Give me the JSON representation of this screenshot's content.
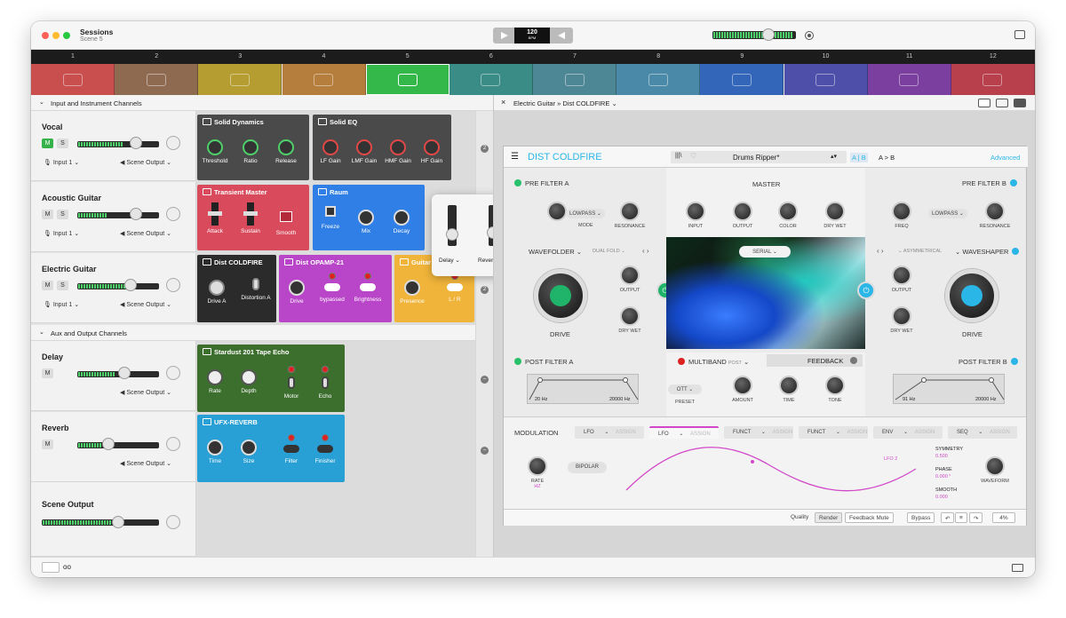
{
  "window": {
    "title": "Sessions",
    "subtitle": "Scene 5",
    "tempo": "120",
    "tempo_unit": "BPM"
  },
  "colors": {
    "accent_green": "#35b34a",
    "blue_power": "#2ab6e6"
  },
  "track_numbers": [
    "1",
    "2",
    "3",
    "4",
    "5",
    "6",
    "7",
    "8",
    "9",
    "10",
    "11",
    "12"
  ],
  "track_colors": [
    "#c94f4f",
    "#8d6a50",
    "#b59d32",
    "#b67e3c",
    "#34b84a",
    "#3a8c86",
    "#4d8694",
    "#4a8aa8",
    "#3366b8",
    "#4e4fa8",
    "#7b3f9f",
    "#b8404c"
  ],
  "sections": {
    "input": "Input and Instrument Channels",
    "aux": "Aux and Output Channels"
  },
  "channels": [
    {
      "name": "Vocal",
      "m": "M",
      "s": "S",
      "input": "Input 1",
      "output": "Scene Output",
      "level": 0.55,
      "thumb": 0.72
    },
    {
      "name": "Acoustic Guitar",
      "m": "M",
      "s": "S",
      "input": "Input 1",
      "output": "Scene Output",
      "level": 0.35,
      "thumb": 0.72
    },
    {
      "name": "Electric Guitar",
      "m": "M",
      "s": "S",
      "input": "Input 1",
      "output": "Scene Output",
      "level": 0.7,
      "thumb": 0.65
    }
  ],
  "aux_channels": [
    {
      "name": "Delay",
      "m": "M",
      "output": "Scene Output",
      "level": 0.45,
      "thumb": 0.58
    },
    {
      "name": "Reverb",
      "m": "M",
      "output": "Scene Output",
      "level": 0.3,
      "thumb": 0.38
    }
  ],
  "scene_output": {
    "name": "Scene Output",
    "level": 0.6,
    "thumb": 0.65
  },
  "plugins": {
    "solid_dynamics": {
      "name": "Solid Dynamics",
      "controls": [
        "Threshold",
        "Ratio",
        "Release"
      ]
    },
    "solid_eq": {
      "name": "Solid EQ",
      "controls": [
        "LF Gain",
        "LMF Gain",
        "HMF Gain",
        "HF Gain"
      ]
    },
    "transient": {
      "name": "Transient Master",
      "controls": [
        "Attack",
        "Sustain",
        "Smooth"
      ]
    },
    "raum": {
      "name": "Raum",
      "controls": [
        "Freeze",
        "Mix",
        "Decay"
      ]
    },
    "dist": {
      "name": "Dist COLDFIRE",
      "controls": [
        "Drive A",
        "Distortion A"
      ]
    },
    "opamp": {
      "name": "Dist OPAMP-21",
      "controls": [
        "Drive",
        "bypassed",
        "Brightness"
      ]
    },
    "guitar": {
      "name": "Guitar",
      "controls": [
        "Presence",
        "L / R"
      ]
    },
    "stardust": {
      "name": "Stardust 201 Tape Echo",
      "controls": [
        "Rate",
        "Depth",
        "Motor",
        "Echo"
      ]
    },
    "ufx": {
      "name": "UFX-REVERB",
      "controls": [
        "Time",
        "Size",
        "Filter",
        "Finisher"
      ]
    }
  },
  "sends_popup": {
    "items": [
      "Delay",
      "Reverb"
    ]
  },
  "editor": {
    "breadcrumb": "Electric Guitar » Dist COLDFIRE"
  },
  "coldfire": {
    "name": "DIST COLDFIRE",
    "preset": "Drums Ripper*",
    "ab": "A | B",
    "a_to_b": "A > B",
    "advanced": "Advanced",
    "pre_filter_a": "PRE FILTER A",
    "pre_filter_b": "PRE FILTER B",
    "master": "MASTER",
    "mode_a": "LOWPASS",
    "mode_b": "LOWPASS",
    "mode_label": "MODE",
    "resonance": "RESONANCE",
    "freq": "FREQ",
    "master_knobs": [
      "INPUT",
      "OUTPUT",
      "COLOR",
      "DRY WET"
    ],
    "wavefolder": "WAVEFOLDER",
    "dual_fold": "DUAL FOLD",
    "waveshaper": "WAVESHAPER",
    "asymmetrical": "ASYMMETRICAL",
    "output": "OUTPUT",
    "dry_wet": "DRY WET",
    "drive": "DRIVE",
    "serial": "SERIAL",
    "multiband": "MULTIBAND",
    "post": "POST",
    "feedback": "FEEDBACK",
    "ott": "OTT",
    "preset_label": "PRESET",
    "fb_knobs": [
      "AMOUNT",
      "TIME",
      "TONE"
    ],
    "post_filter_a": "POST FILTER A",
    "post_filter_b": "POST FILTER B",
    "pfa_low": "20 Hz",
    "pfa_high": "20000 Hz",
    "pfb_low": "91 Hz",
    "pfb_high": "20000 Hz",
    "modulation": "MODULATION",
    "mod_tabs": [
      "LFO",
      "LFO",
      "FUNCT",
      "FUNCT",
      "ENV",
      "SEQ"
    ],
    "assign": "ASSIGN",
    "rate": "RATE",
    "rate_unit": "HZ",
    "bipolar": "BIPOLAR",
    "lfo2": "LFO 2",
    "symmetry": "SYMMETRY",
    "symmetry_val": "0.500",
    "phase": "PHASE",
    "phase_val": "0.000 °",
    "smooth": "SMOOTH",
    "smooth_val": "0.000",
    "waveform": "WAVEFORM",
    "footer": {
      "quality": "Quality",
      "render": "Render",
      "feedback_mute": "Feedback Mute",
      "bypass": "Bypass",
      "zoom": "4%"
    }
  }
}
